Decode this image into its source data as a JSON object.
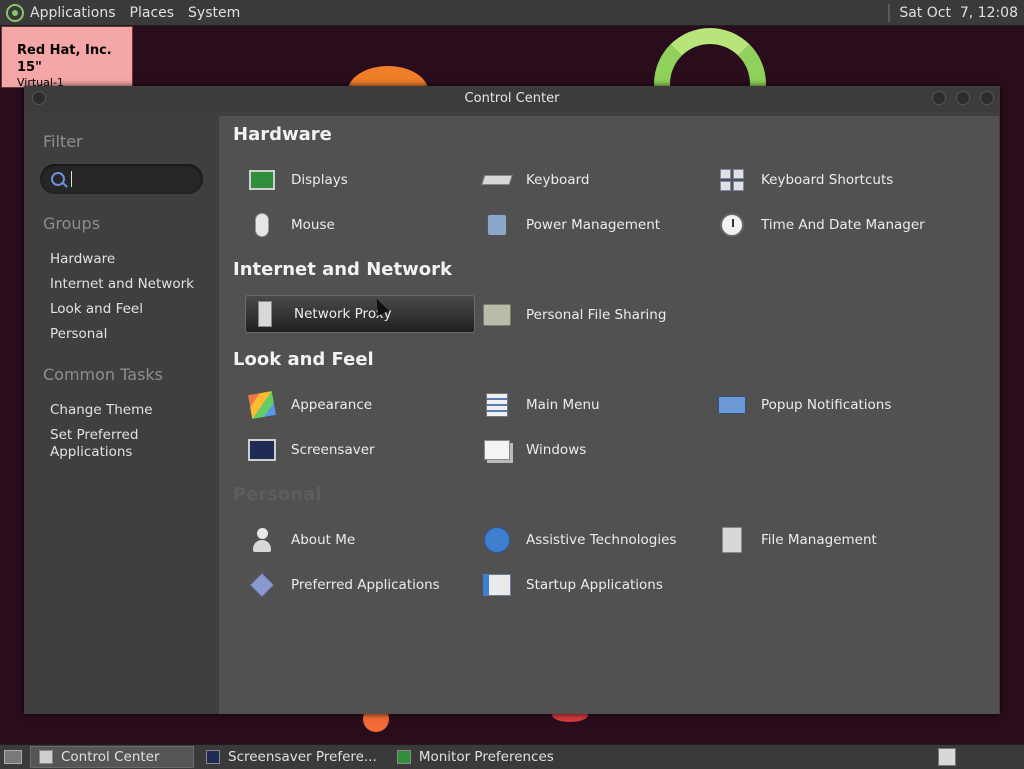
{
  "top_panel": {
    "menus": [
      "Applications",
      "Places",
      "System"
    ],
    "clock": "Sat Oct  7, 12:08"
  },
  "osd": {
    "title": "Red Hat, Inc. 15\"",
    "subtitle": "Virtual-1"
  },
  "window": {
    "title": "Control Center",
    "sidebar": {
      "filter_label": "Filter",
      "search_value": "",
      "groups_label": "Groups",
      "groups": [
        "Hardware",
        "Internet and Network",
        "Look and Feel",
        "Personal"
      ],
      "tasks_label": "Common Tasks",
      "tasks": [
        "Change Theme",
        "Set Preferred Applications"
      ]
    },
    "sections": [
      {
        "title": "Hardware",
        "items": [
          {
            "label": "Displays",
            "icon": "display-icon"
          },
          {
            "label": "Keyboard",
            "icon": "keyboard-icon"
          },
          {
            "label": "Keyboard Shortcuts",
            "icon": "keyboard-shortcuts-icon"
          },
          {
            "label": "Mouse",
            "icon": "mouse-icon"
          },
          {
            "label": "Power Management",
            "icon": "power-management-icon"
          },
          {
            "label": "Time And Date Manager",
            "icon": "clock-icon"
          }
        ]
      },
      {
        "title": "Internet and Network",
        "items": [
          {
            "label": "Network Proxy",
            "icon": "network-proxy-icon"
          },
          {
            "label": "Personal File Sharing",
            "icon": "folder-share-icon"
          }
        ]
      },
      {
        "title": "Look and Feel",
        "items": [
          {
            "label": "Appearance",
            "icon": "appearance-icon"
          },
          {
            "label": "Main Menu",
            "icon": "main-menu-icon"
          },
          {
            "label": "Popup Notifications",
            "icon": "popup-notifications-icon"
          },
          {
            "label": "Screensaver",
            "icon": "screensaver-icon"
          },
          {
            "label": "Windows",
            "icon": "windows-icon"
          }
        ]
      },
      {
        "title": "Personal",
        "items": [
          {
            "label": "About Me",
            "icon": "about-me-icon"
          },
          {
            "label": "Assistive Technologies",
            "icon": "accessibility-icon"
          },
          {
            "label": "File Management",
            "icon": "file-management-icon"
          },
          {
            "label": "Preferred Applications",
            "icon": "preferred-apps-icon"
          },
          {
            "label": "Startup Applications",
            "icon": "startup-apps-icon"
          }
        ]
      }
    ]
  },
  "taskbar": {
    "tasks": [
      "Control Center",
      "Screensaver Prefere...",
      "Monitor Preferences"
    ]
  }
}
